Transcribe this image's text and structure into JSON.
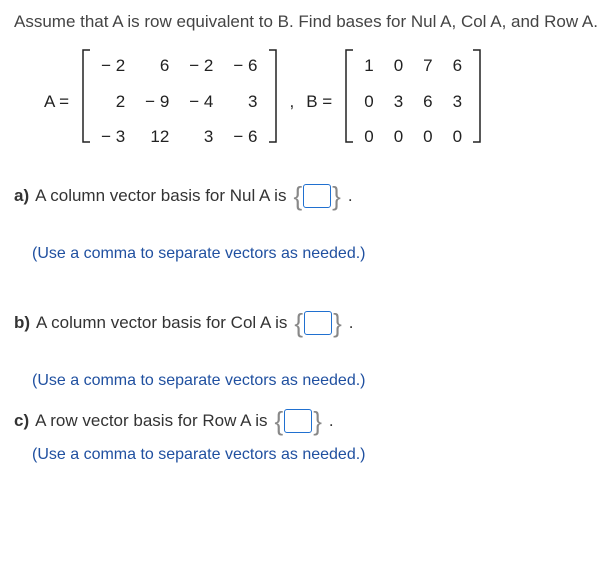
{
  "intro": "Assume that A is row equivalent to B. Find bases for Nul A, Col A, and Row A.",
  "matA_label": "A =",
  "matA": [
    [
      "− 2",
      "6",
      "− 2",
      "− 6"
    ],
    [
      "2",
      "− 9",
      "− 4",
      "3"
    ],
    [
      "− 3",
      "12",
      "3",
      "− 6"
    ]
  ],
  "comma": ",",
  "matB_label": "B =",
  "matB": [
    [
      "1",
      "0",
      "7",
      "6"
    ],
    [
      "0",
      "3",
      "6",
      "3"
    ],
    [
      "0",
      "0",
      "0",
      "0"
    ]
  ],
  "qa_label": "a)",
  "qa_text_1": " A column vector basis for Nul A is ",
  "qa_after": ".",
  "hint_a": "(Use a comma to separate vectors as needed.)",
  "qb_label": "b)",
  "qb_text_1": " A column vector basis for Col A is ",
  "qb_after": ".",
  "hint_b": "(Use a comma to separate vectors as needed.)",
  "qc_label": "c)",
  "qc_text_1": " A row vector basis for Row A is ",
  "qc_after": ".",
  "hint_c": "(Use a comma to separate vectors as needed.)"
}
